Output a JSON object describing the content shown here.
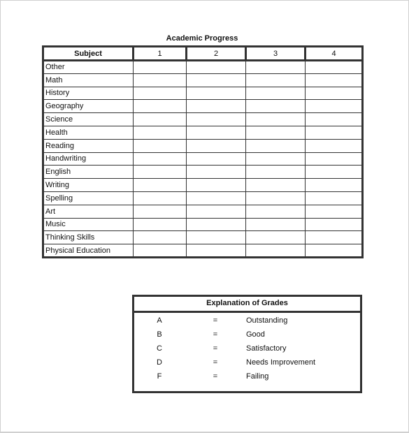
{
  "progress": {
    "title": "Academic Progress",
    "columns": [
      "Subject",
      "1",
      "2",
      "3",
      "4"
    ],
    "subjects": [
      "Other",
      "Math",
      "History",
      "Geography",
      "Science",
      "Health",
      "Reading",
      "Handwriting",
      "English",
      "Writing",
      "Spelling",
      "Art",
      "Music",
      "Thinking Skills",
      "Physical Education"
    ]
  },
  "grades": {
    "title": "Explanation of Grades",
    "items": [
      {
        "letter": "A",
        "eq": "=",
        "desc": "Outstanding"
      },
      {
        "letter": "B",
        "eq": "=",
        "desc": "Good"
      },
      {
        "letter": "C",
        "eq": "=",
        "desc": "Satisfactory"
      },
      {
        "letter": "D",
        "eq": "=",
        "desc": "Needs Improvement"
      },
      {
        "letter": "F",
        "eq": "=",
        "desc": "Failing"
      }
    ]
  }
}
